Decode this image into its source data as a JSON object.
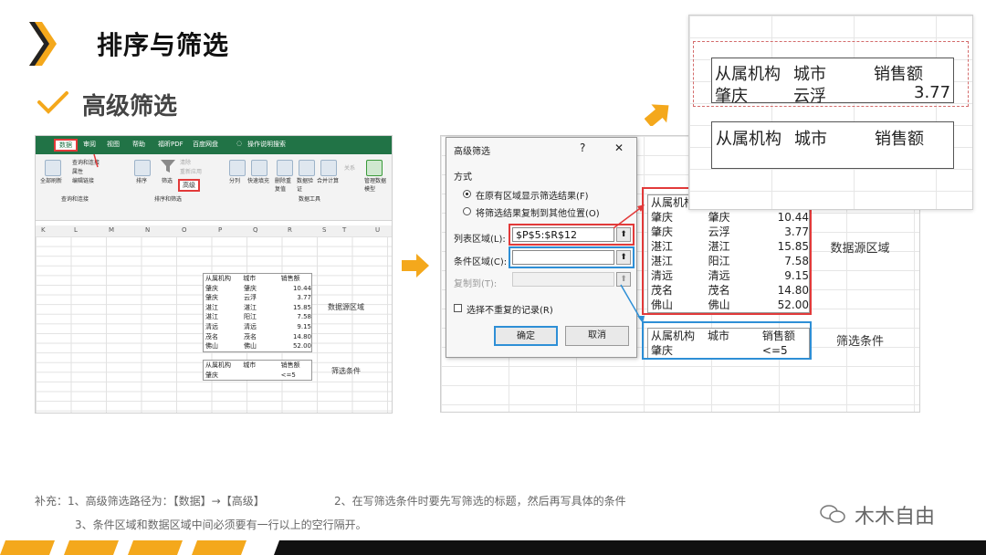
{
  "header": {
    "title": "排序与筛选",
    "subtitle": "高级筛选"
  },
  "colors": {
    "accent": "#F4A81C",
    "excel_green": "#217346",
    "highlight_red": "#E23A3A",
    "highlight_blue": "#2E8FD6"
  },
  "excel_left": {
    "tabs": [
      "数据",
      "审阅",
      "视图",
      "帮助",
      "福昕PDF",
      "百度网盘",
      "操作说明搜索"
    ],
    "ribbon": {
      "refresh_all": "全部刷新",
      "query_connect": "查询和连接",
      "attributes": "属性",
      "edit_links": "编辑链接",
      "group_query": "查询和连接",
      "sort": "排序",
      "filter": "筛选",
      "clear": "清除",
      "reapply": "重新应用",
      "advanced": "高级",
      "group_sort": "排序和筛选",
      "split": "分列",
      "flash_fill": "快速填充",
      "remove_dup": "删除重复值",
      "validate": "数据验证",
      "consolidate": "合并计算",
      "relations": "关系",
      "data_model": "管理数据模型",
      "group_tools": "数据工具"
    },
    "columns": [
      "K",
      "L",
      "M",
      "N",
      "O",
      "P",
      "Q",
      "R",
      "S",
      "T",
      "U"
    ],
    "source_label": "数据源区域",
    "criteria_label": "筛选条件"
  },
  "table": {
    "headers": [
      "从属机构",
      "城市",
      "销售额"
    ],
    "rows": [
      [
        "肇庆",
        "肇庆",
        "10.44"
      ],
      [
        "肇庆",
        "云浮",
        "3.77"
      ],
      [
        "湛江",
        "湛江",
        "15.85"
      ],
      [
        "湛江",
        "阳江",
        "7.58"
      ],
      [
        "清远",
        "清远",
        "9.15"
      ],
      [
        "茂名",
        "茂名",
        "14.80"
      ],
      [
        "佛山",
        "佛山",
        "52.00"
      ]
    ]
  },
  "criteria": {
    "headers": [
      "从属机构",
      "城市",
      "销售额"
    ],
    "row": [
      "肇庆",
      "",
      "<=5"
    ]
  },
  "dialog": {
    "title": "高级筛选",
    "help": "?",
    "close": "✕",
    "mode_label": "方式",
    "option1": "在原有区域显示筛选结果(F)",
    "option2": "将筛选结果复制到其他位置(O)",
    "list_range_label": "列表区域(L):",
    "list_range_value": "$P$5:$R$12",
    "criteria_range_label": "条件区域(C):",
    "criteria_range_value": "",
    "copy_to_label": "复制到(T):",
    "unique_label": "选择不重复的记录(R)",
    "ok": "确定",
    "cancel": "取消"
  },
  "zoom_panel": {
    "source_label": "数据源区域",
    "criteria_label": "筛选条件"
  },
  "result": {
    "headers": [
      "从属机构",
      "城市",
      "销售额"
    ],
    "row": [
      "肇庆",
      "云浮",
      "3.77"
    ],
    "headers2": [
      "从属机构",
      "城市",
      "销售额"
    ]
  },
  "notes": {
    "line1_a": "补充：1、高级筛选路径为：【数据】→【高级】",
    "line1_b": "2、在写筛选条件时要先写筛选的标题，然后再写具体的条件",
    "line2": "3、条件区域和数据区域中间必须要有一行以上的空行隔开。"
  },
  "brand": "木木自由"
}
